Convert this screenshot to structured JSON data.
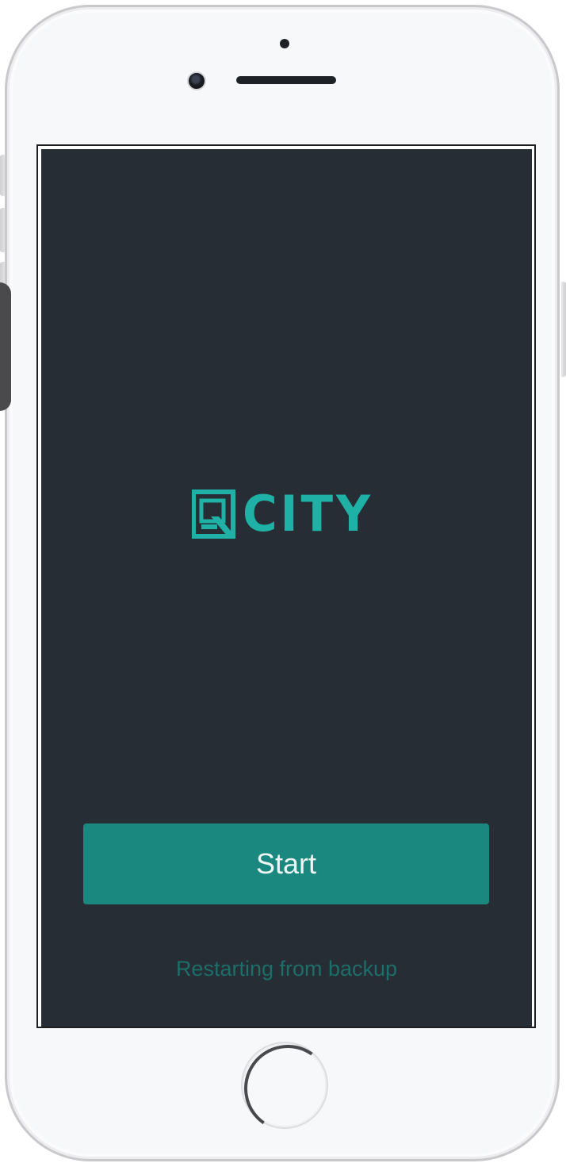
{
  "app": {
    "logo_text": "CITY",
    "brand_color": "#1fb1a6",
    "background_color": "#272d34"
  },
  "main": {
    "start_label": "Start",
    "restore_label": "Restarting from backup"
  },
  "icons": {
    "logo_mark": "q-square-icon",
    "home": "home-button-icon",
    "camera": "front-camera-icon"
  }
}
